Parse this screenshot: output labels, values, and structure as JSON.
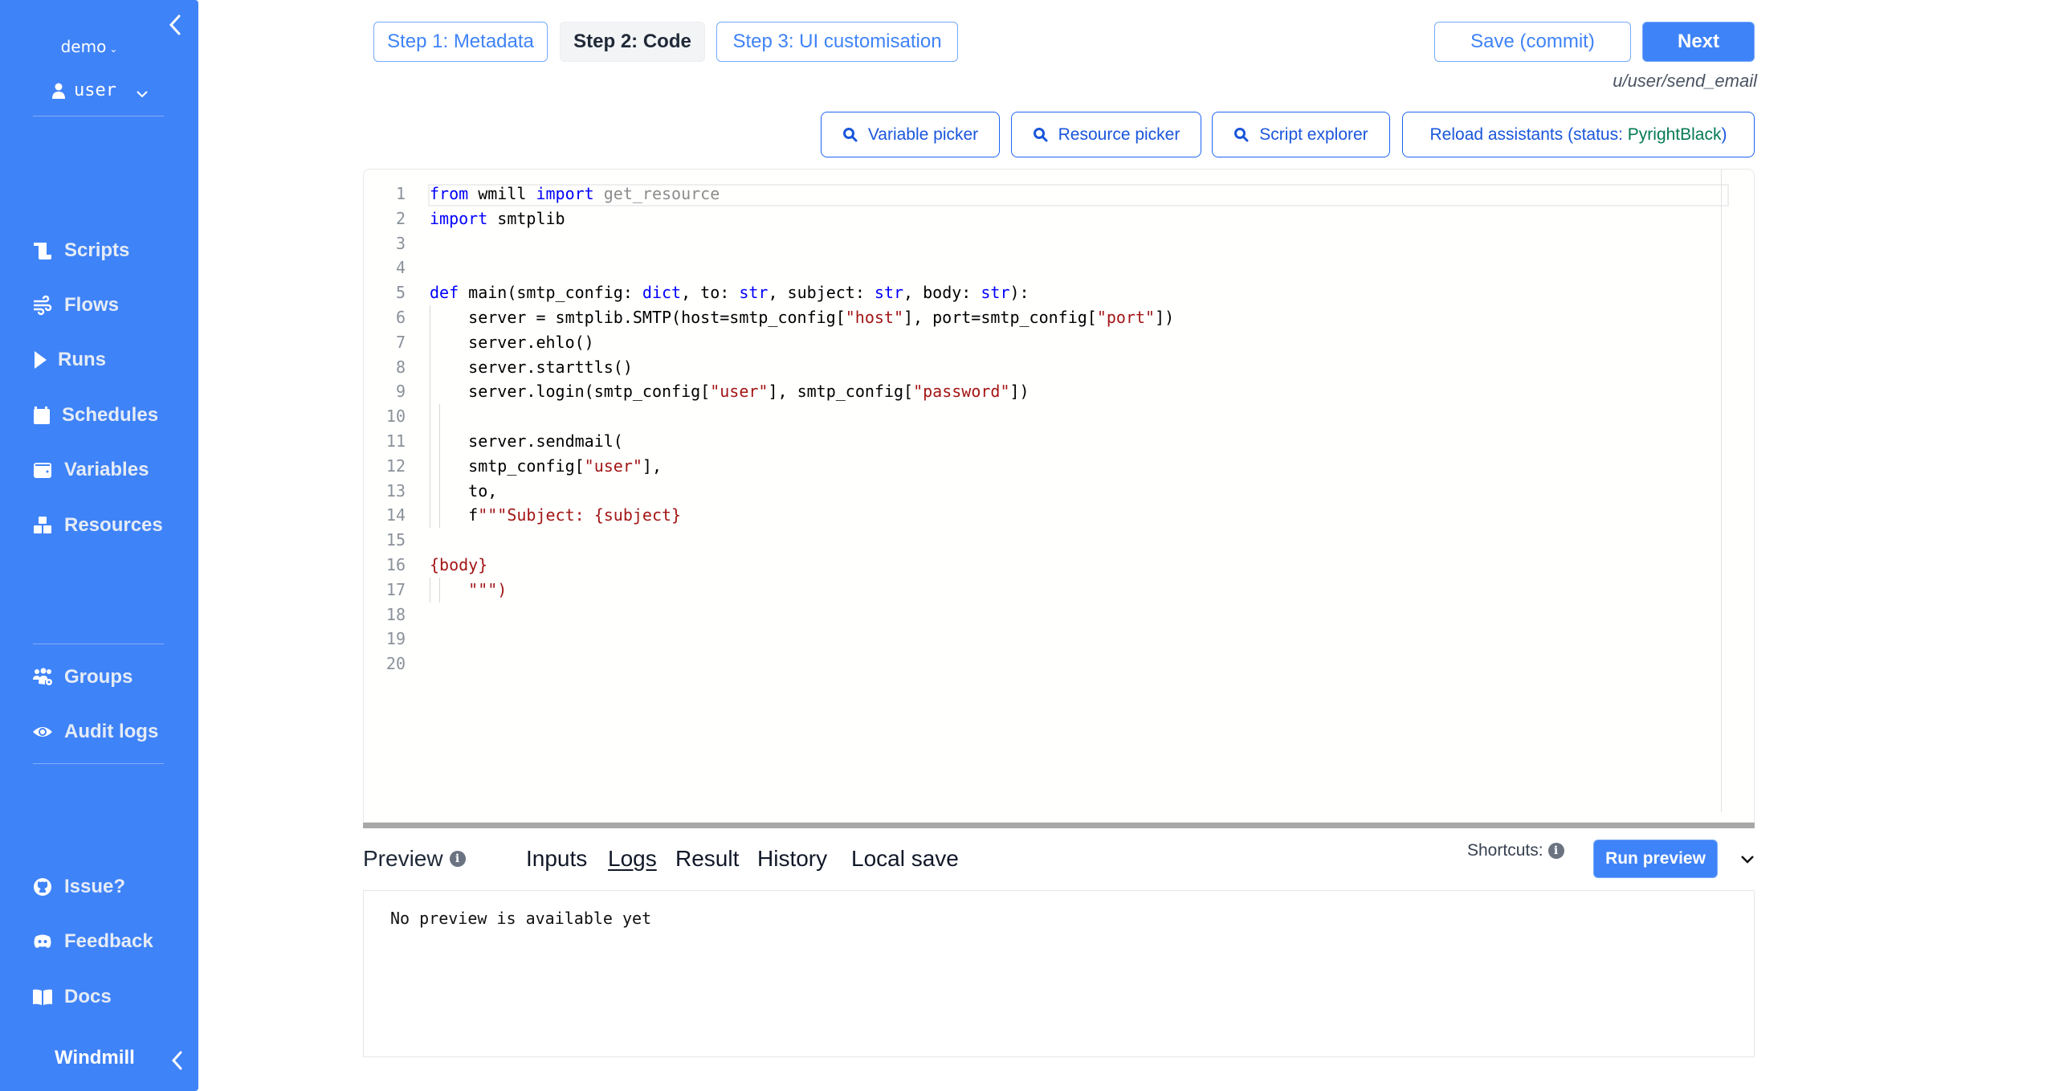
{
  "sidebar": {
    "workspace": "demo",
    "user": "user",
    "nav_main": [
      {
        "label": "Scripts",
        "icon": "scroll-icon"
      },
      {
        "label": "Flows",
        "icon": "wind-icon"
      },
      {
        "label": "Runs",
        "icon": "play-icon"
      },
      {
        "label": "Schedules",
        "icon": "calendar-icon"
      },
      {
        "label": "Variables",
        "icon": "wallet-icon"
      },
      {
        "label": "Resources",
        "icon": "cubes-icon"
      }
    ],
    "nav_admin": [
      {
        "label": "Groups",
        "icon": "users-cog-icon"
      },
      {
        "label": "Audit logs",
        "icon": "eye-icon"
      }
    ],
    "nav_footer": [
      {
        "label": "Issue?",
        "icon": "github-icon"
      },
      {
        "label": "Feedback",
        "icon": "discord-icon"
      },
      {
        "label": "Docs",
        "icon": "book-icon"
      }
    ],
    "brand": "Windmill"
  },
  "header": {
    "steps": [
      {
        "label": "Step 1: Metadata",
        "active": false
      },
      {
        "label": "Step 2: Code",
        "active": true
      },
      {
        "label": "Step 3: UI customisation",
        "active": false
      }
    ],
    "save_label": "Save (commit)",
    "next_label": "Next",
    "script_path": "u/user/send_email"
  },
  "toolbar": {
    "variable_picker": "Variable picker",
    "resource_picker": "Resource picker",
    "script_explorer": "Script explorer",
    "reload_prefix": "Reload assistants (status: ",
    "reload_status": "PyrightBlack",
    "reload_suffix": ")",
    "status_color": "#057a55"
  },
  "editor": {
    "language": "python",
    "lines": [
      "from wmill import get_resource",
      "import smtplib",
      "",
      "",
      "def main(smtp_config: dict, to: str, subject: str, body: str):",
      "    server = smtplib.SMTP(host=smtp_config[\"host\"], port=smtp_config[\"port\"])",
      "    server.ehlo()",
      "    server.starttls()",
      "    server.login(smtp_config[\"user\"], smtp_config[\"password\"])",
      "",
      "    server.sendmail(",
      "    smtp_config[\"user\"],",
      "    to,",
      "    f\"\"\"Subject: {subject}",
      "",
      "{body}",
      "    \"\"\")",
      "",
      "",
      ""
    ]
  },
  "preview": {
    "title": "Preview",
    "tabs": [
      {
        "label": "Inputs",
        "active": false
      },
      {
        "label": "Logs",
        "active": true
      },
      {
        "label": "Result",
        "active": false
      },
      {
        "label": "History",
        "active": false
      },
      {
        "label": "Local save",
        "active": false
      }
    ],
    "shortcuts_label": "Shortcuts:",
    "run_label": "Run preview",
    "empty_message": "No preview is available yet"
  },
  "colors": {
    "sidebar_bg": "#3f83f8",
    "primary": "#3f83f8",
    "keyword": "#0000ff",
    "string": "#a31515"
  }
}
